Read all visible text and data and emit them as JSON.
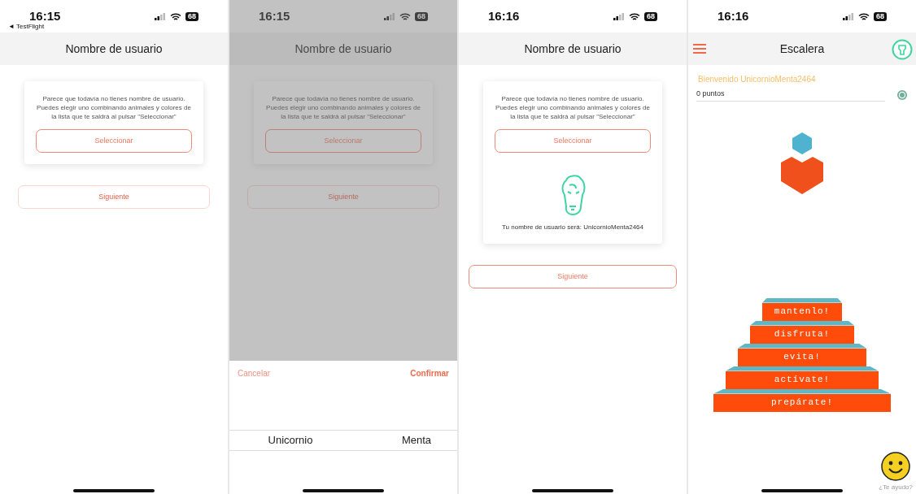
{
  "screens": [
    {
      "kind": "username",
      "status": {
        "time": "16:15",
        "back_link": "◄ TestFlight",
        "battery": "68"
      },
      "title": "Nombre de usuario",
      "message": "Parece que todavía no tienes nombre de usuario. Puedes elegir uno combinando animales y colores de la lista que te saldrá al pulsar \"Seleccionar\"",
      "select_button": "Seleccionar",
      "next_button": {
        "label": "Siguiente",
        "disabled": true
      }
    },
    {
      "kind": "username",
      "status": {
        "time": "16:15",
        "battery": "68"
      },
      "title": "Nombre de usuario",
      "message": "Parece que todavía no tienes nombre de usuario. Puedes elegir uno combinando animales y colores de la lista que te saldrá al pulsar \"Seleccionar\"",
      "select_button": "Seleccionar",
      "next_button": {
        "label": "Siguiente",
        "disabled": true
      },
      "picker": {
        "cancel": "Cancelar",
        "confirm": "Confirmar",
        "columns": [
          {
            "selected": "Unicornio"
          },
          {
            "selected": "Menta"
          }
        ]
      }
    },
    {
      "kind": "username",
      "status": {
        "time": "16:16",
        "battery": "68"
      },
      "title": "Nombre de usuario",
      "message": "Parece que todavía no tienes nombre de usuario. Puedes elegir uno combinando animales y colores de la lista que te saldrá al pulsar \"Seleccionar\"",
      "select_button": "Seleccionar",
      "result": "Tu nombre de usuario será: UnicornioMenta2464",
      "next_button": {
        "label": "Siguiente",
        "disabled": false
      }
    },
    {
      "kind": "ladder",
      "status": {
        "time": "16:16",
        "battery": "68"
      },
      "title": "Escalera",
      "welcome": "Bienvenido UnicornioMenta2464",
      "points": "0 puntos",
      "steps": [
        "mantenlo!",
        "disfruta!",
        "evita!",
        "actívate!",
        "prepárate!"
      ],
      "help": "¿Te ayudo?"
    }
  ]
}
